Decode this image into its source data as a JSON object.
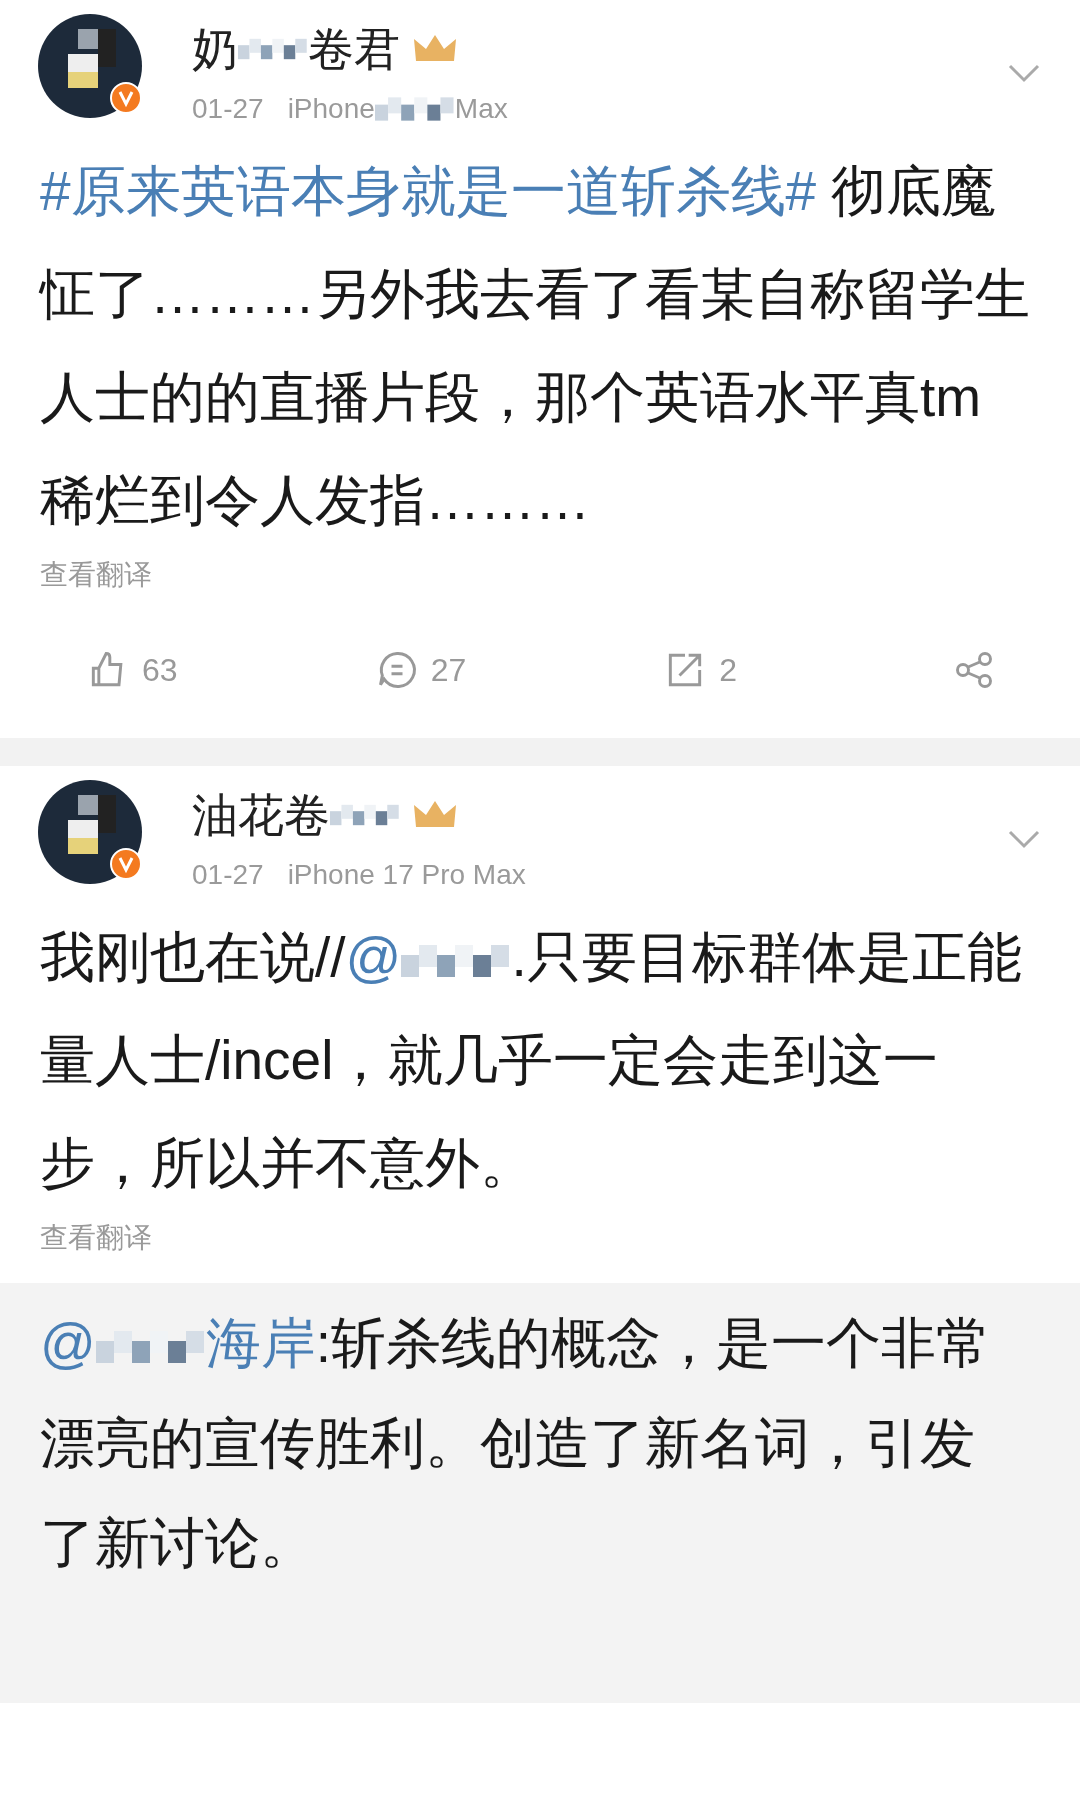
{
  "posts": [
    {
      "author": {
        "name_parts": [
          "奶",
          "卷君"
        ]
      },
      "date": "01-27",
      "device_parts": [
        "iPhone",
        "Max"
      ],
      "body": [
        {
          "kind": "link",
          "text": "#原来英语本身就是一道斩杀线#"
        },
        {
          "kind": "text",
          "text": " 彻底魔怔了………另外我去看了看某自称留学生人士的的直播片段，那个英语水平真tm稀烂到令人发指………"
        }
      ],
      "translate": "查看翻译",
      "actions": [
        {
          "kind": "like",
          "count": "63"
        },
        {
          "kind": "comment",
          "count": "27"
        },
        {
          "kind": "repost",
          "count": "2"
        },
        {
          "kind": "share"
        }
      ]
    },
    {
      "author": {
        "name_parts": [
          "油花卷"
        ]
      },
      "date": "01-27",
      "device_parts": [
        "iPhone 17 Pro Max"
      ],
      "body": [
        {
          "kind": "text",
          "text": "我刚也在说//"
        },
        {
          "kind": "link",
          "text": "@"
        },
        {
          "kind": "mosaic"
        },
        {
          "kind": "text",
          "text": ".只要目标群体是正能量人士/incel，就几乎一定会走到这一步，所以并不意外。"
        }
      ],
      "translate": "查看翻译"
    }
  ],
  "quoted": {
    "body": [
      {
        "kind": "link",
        "text": "@"
      },
      {
        "kind": "mosaic"
      },
      {
        "kind": "link",
        "text": "海岸"
      },
      {
        "kind": "text",
        "text": ":斩杀线的概念，是一个非常漂亮的宣传胜利。创造了新名词，引发了新讨论。"
      }
    ]
  }
}
